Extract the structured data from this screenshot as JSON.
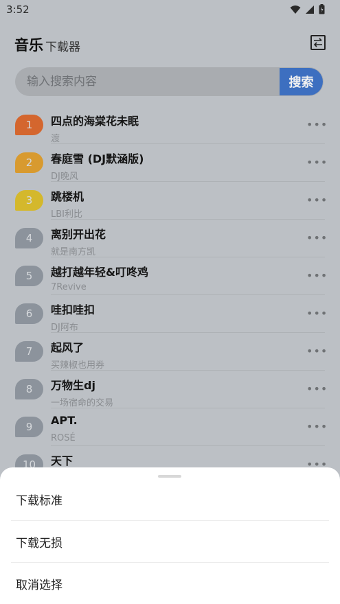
{
  "status_bar": {
    "time": "3:52"
  },
  "header": {
    "title": "音乐",
    "subtitle": "下载器",
    "switch_icon": "swap-icon"
  },
  "search": {
    "placeholder": "输入搜索内容",
    "button_label": "搜索"
  },
  "songs": [
    {
      "rank": "1",
      "title": "四点的海棠花未眠",
      "artist": "渡",
      "badge_color": "#d4662e"
    },
    {
      "rank": "2",
      "title": "春庭雪 (DJ默涵版)",
      "artist": "DJ晚风",
      "badge_color": "#d89a2f"
    },
    {
      "rank": "3",
      "title": "跳楼机",
      "artist": "LBI利比",
      "badge_color": "#d4b82c"
    },
    {
      "rank": "4",
      "title": "离别开出花",
      "artist": "就是南方凯",
      "badge_color": "#8c939c"
    },
    {
      "rank": "5",
      "title": "越打越年轻&叮咚鸡",
      "artist": "7Revive",
      "badge_color": "#8c939c"
    },
    {
      "rank": "6",
      "title": "哇扣哇扣",
      "artist": "DJ阿布",
      "badge_color": "#8c939c"
    },
    {
      "rank": "7",
      "title": "起风了",
      "artist": "买辣椒也用券",
      "badge_color": "#8c939c"
    },
    {
      "rank": "8",
      "title": "万物生dj",
      "artist": "一场宿命的交易",
      "badge_color": "#8c939c"
    },
    {
      "rank": "9",
      "title": "APT.",
      "artist": "ROSÉ",
      "badge_color": "#8c939c"
    },
    {
      "rank": "10",
      "title": "天下",
      "artist": "",
      "badge_color": "#8c939c"
    }
  ],
  "more_label": "•••",
  "sheet": {
    "options": [
      "下载标准",
      "下载无损",
      "取消选择"
    ]
  }
}
